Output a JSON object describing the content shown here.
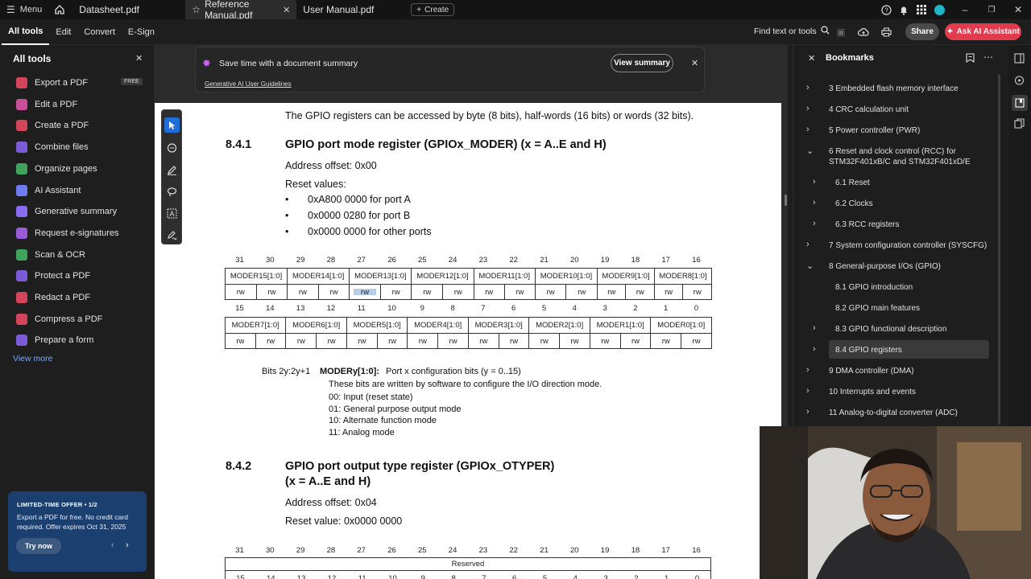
{
  "tabbar": {
    "menu_label": "Menu",
    "tabs": [
      {
        "label": "Datasheet.pdf"
      },
      {
        "label": "Reference Manual.pdf"
      },
      {
        "label": "User Manual.pdf"
      }
    ],
    "create_label": "Create"
  },
  "menubar": {
    "items": [
      "All tools",
      "Edit",
      "Convert",
      "E-Sign"
    ],
    "find_label": "Find text or tools",
    "share_label": "Share",
    "ai_label": "Ask AI Assistant"
  },
  "all_tools": {
    "title": "All tools",
    "items": [
      {
        "label": "Export a PDF",
        "color": "#d3455b",
        "badge": "FREE"
      },
      {
        "label": "Edit a PDF",
        "color": "#c94f9b"
      },
      {
        "label": "Create a PDF",
        "color": "#d3455b"
      },
      {
        "label": "Combine files",
        "color": "#7b5cd6"
      },
      {
        "label": "Organize pages",
        "color": "#3fa35b"
      },
      {
        "label": "AI Assistant",
        "color": "#6f7cf0"
      },
      {
        "label": "Generative summary",
        "color": "#8a6cf0"
      },
      {
        "label": "Request e-signatures",
        "color": "#9a5ad6"
      },
      {
        "label": "Scan & OCR",
        "color": "#3fa35b"
      },
      {
        "label": "Protect a PDF",
        "color": "#7b5cd6"
      },
      {
        "label": "Redact a PDF",
        "color": "#d3455b"
      },
      {
        "label": "Compress a PDF",
        "color": "#d3455b"
      },
      {
        "label": "Prepare a form",
        "color": "#7b5cd6"
      }
    ],
    "view_more": "View more"
  },
  "offer": {
    "heading": "LIMITED-TIME OFFER • 1/2",
    "text": "Export a PDF for free. No credit card required. Offer expires Oct 31, 2025",
    "button": "Try now"
  },
  "banner": {
    "text": "Save time with a document summary",
    "link": "Generative AI User Guidelines",
    "button": "View summary"
  },
  "doc": {
    "intro": "The GPIO registers can be accessed by byte (8 bits), half-words (16 bits) or words (32 bits).",
    "s1_num": "8.4.1",
    "s1_title": "GPIO port mode register (GPIOx_MODER) (x = A..E and H)",
    "s1_offset": "Address offset: 0x00",
    "s1_reset_label": "Reset values:",
    "s1_resets": [
      "0xA800 0000 for port A",
      "0x0000 0280 for port B",
      "0x0000 0000 for other ports"
    ],
    "bits_high": [
      "31",
      "30",
      "29",
      "28",
      "27",
      "26",
      "25",
      "24",
      "23",
      "22",
      "21",
      "20",
      "19",
      "18",
      "17",
      "16"
    ],
    "bits_low": [
      "15",
      "14",
      "13",
      "12",
      "11",
      "10",
      "9",
      "8",
      "7",
      "6",
      "5",
      "4",
      "3",
      "2",
      "1",
      "0"
    ],
    "fields_high": [
      "MODER15[1:0]",
      "MODER14[1:0]",
      "MODER13[1:0]",
      "MODER12[1:0]",
      "MODER11[1:0]",
      "MODER10[1:0]",
      "MODER9[1:0]",
      "MODER8[1:0]"
    ],
    "fields_low": [
      "MODER7[1:0]",
      "MODER6[1:0]",
      "MODER5[1:0]",
      "MODER4[1:0]",
      "MODER3[1:0]",
      "MODER2[1:0]",
      "MODER1[1:0]",
      "MODER0[1:0]"
    ],
    "access": "rw",
    "bits_label": "Bits 2y:2y+1",
    "bits_field": "MODERy[1:0]:",
    "bits_desc": "Port x configuration bits (y = 0..15)",
    "bits_line2": "These bits are written by software to configure the I/O direction mode.",
    "modes": [
      "00: Input (reset state)",
      "01: General purpose output mode",
      "10: Alternate function mode",
      "11: Analog mode"
    ],
    "s2_num": "8.4.2",
    "s2_title_1": "GPIO port output type register (GPIOx_OTYPER)",
    "s2_title_2": "(x = A..E and H)",
    "s2_offset": "Address offset: 0x04",
    "s2_reset": "Reset value: 0x0000 0000",
    "reserved": "Reserved"
  },
  "bookmarks": {
    "title": "Bookmarks",
    "items": [
      {
        "label": "3 Embedded flash memory interface",
        "level": 0,
        "chev": "›"
      },
      {
        "label": "4 CRC calculation unit",
        "level": 0,
        "chev": "›"
      },
      {
        "label": "5 Power controller (PWR)",
        "level": 0,
        "chev": "›"
      },
      {
        "label": "6 Reset and clock control (RCC) for STM32F401xB/C and STM32F401xD/E",
        "level": 0,
        "chev": "⌄"
      },
      {
        "label": "6.1 Reset",
        "level": 1,
        "chev": "›"
      },
      {
        "label": "6.2 Clocks",
        "level": 1,
        "chev": "›"
      },
      {
        "label": "6.3 RCC registers",
        "level": 1,
        "chev": "›"
      },
      {
        "label": "7 System configuration controller (SYSCFG)",
        "level": 0,
        "chev": "›"
      },
      {
        "label": "8 General-purpose I/Os (GPIO)",
        "level": 0,
        "chev": "⌄"
      },
      {
        "label": "8.1 GPIO introduction",
        "level": 1,
        "chev": ""
      },
      {
        "label": "8.2 GPIO main features",
        "level": 1,
        "chev": ""
      },
      {
        "label": "8.3 GPIO functional description",
        "level": 1,
        "chev": "›"
      },
      {
        "label": "8.4 GPIO registers",
        "level": 1,
        "chev": "›",
        "selected": true
      },
      {
        "label": "9 DMA controller (DMA)",
        "level": 0,
        "chev": "›"
      },
      {
        "label": "10 Interrupts and events",
        "level": 0,
        "chev": "›"
      },
      {
        "label": "11 Analog-to-digital converter (ADC)",
        "level": 0,
        "chev": "›"
      }
    ]
  }
}
